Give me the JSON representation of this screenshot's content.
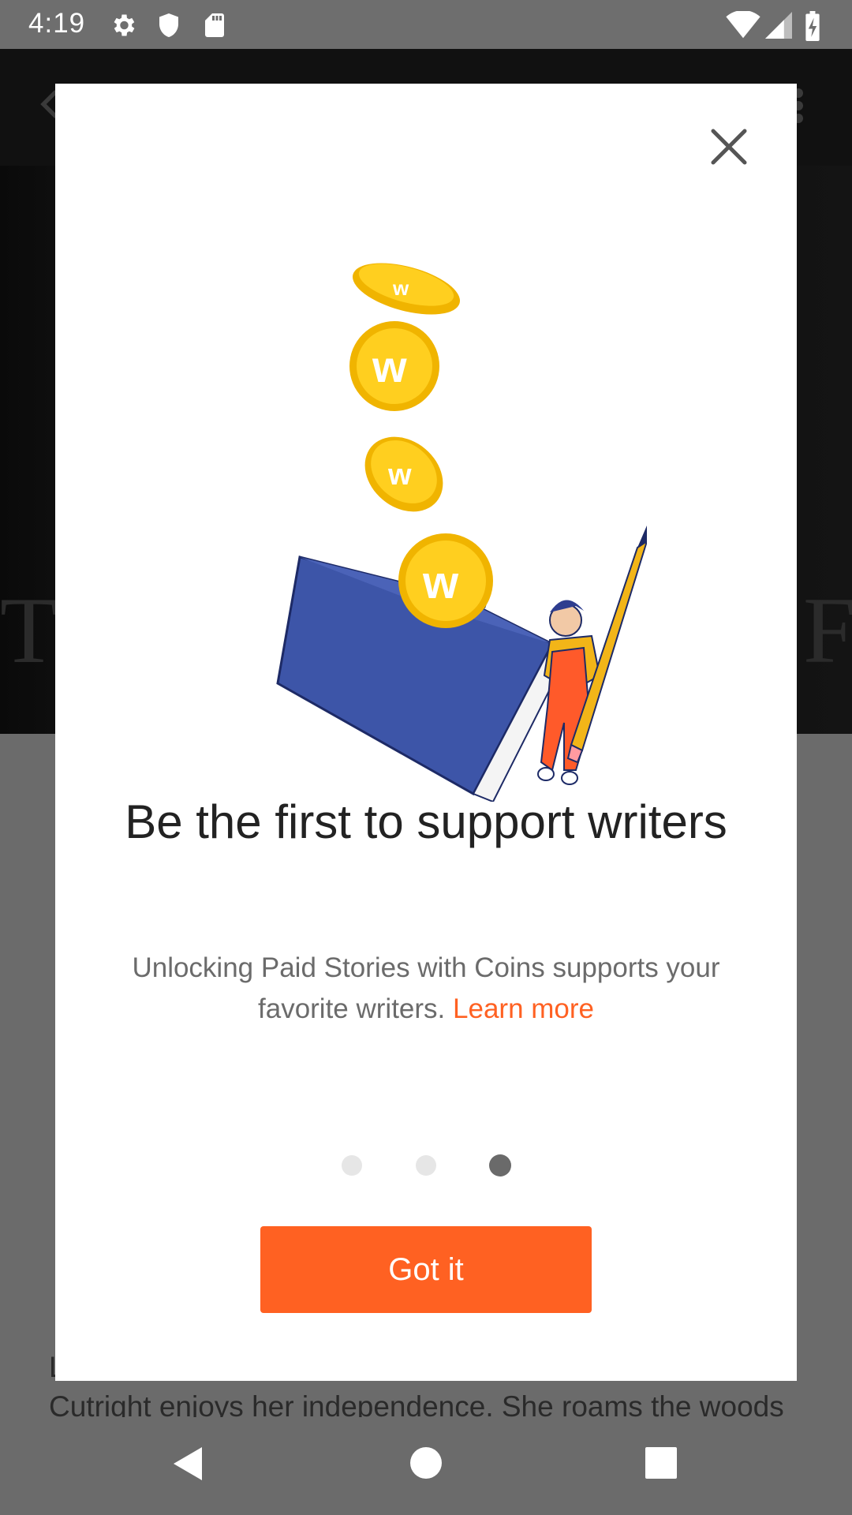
{
  "status_bar": {
    "time": "4:19",
    "left_icons": [
      "settings-icon",
      "shield-icon",
      "sd-card-icon"
    ],
    "right_icons": [
      "wifi-icon",
      "signal-icon",
      "battery-charging-icon"
    ]
  },
  "background_app": {
    "description_line_1": "L",
    "description_line_2": "Cutright enjoys her independence. She roams the woods"
  },
  "dialog": {
    "title": "Be the first to support writers",
    "body": "Unlocking Paid Stories with Coins supports your favorite writers.",
    "learn_more": "Learn more",
    "page_count": 3,
    "active_page": 3,
    "button_label": "Got it",
    "accent_color": "#ff6122"
  },
  "nav_bar": {
    "buttons": [
      "back-icon",
      "home-icon",
      "recents-icon"
    ]
  }
}
